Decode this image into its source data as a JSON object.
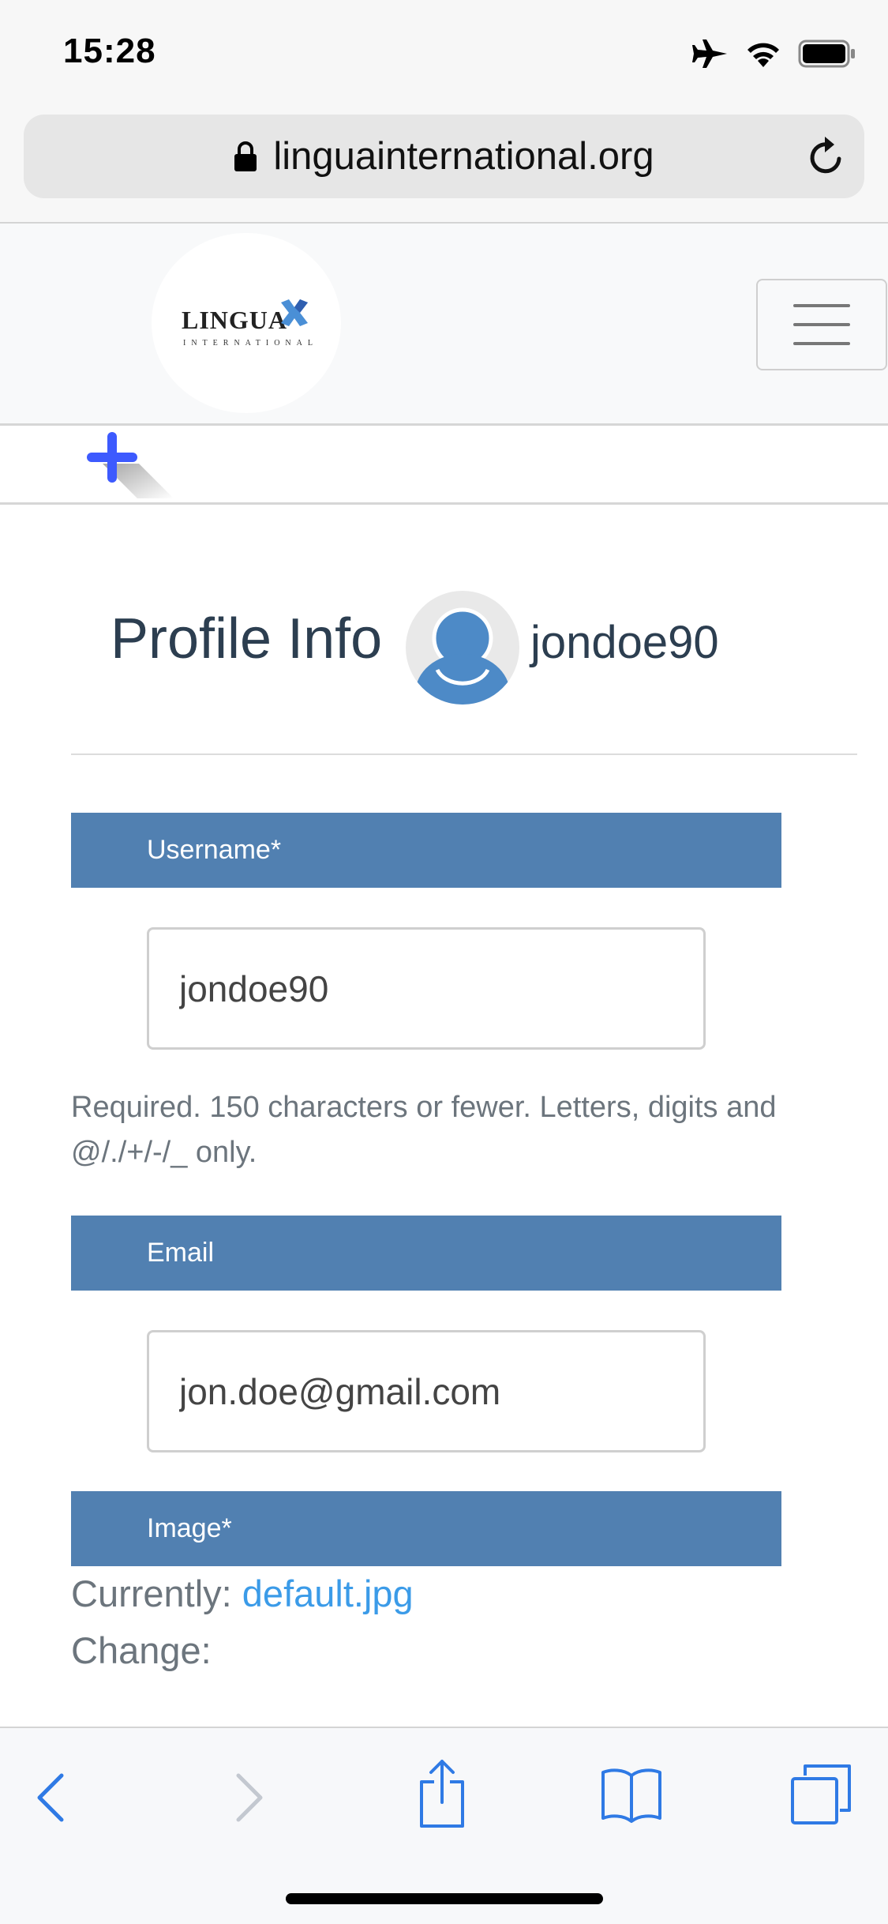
{
  "status": {
    "time": "15:28"
  },
  "browser": {
    "url": "linguainternational.org"
  },
  "site": {
    "logo_text": "LINGUA",
    "logo_sub": "INTERNATIONAL"
  },
  "profile": {
    "title": "Profile Info",
    "username": "jondoe90"
  },
  "form": {
    "username_label": "Username*",
    "username_value": "jondoe90",
    "username_help": "Required. 150 characters or fewer. Letters, digits and @/./+/-/_ only.",
    "email_label": "Email",
    "email_value": "jon.doe@gmail.com",
    "image_label": "Image*",
    "currently_label": "Currently:",
    "current_file": "default.jpg",
    "change_label": "Change:"
  },
  "colors": {
    "section_bar": "#5180b1",
    "link": "#3b9be8",
    "toolbar_icon": "#2f7ae5",
    "plus_icon": "#3d5afe"
  }
}
